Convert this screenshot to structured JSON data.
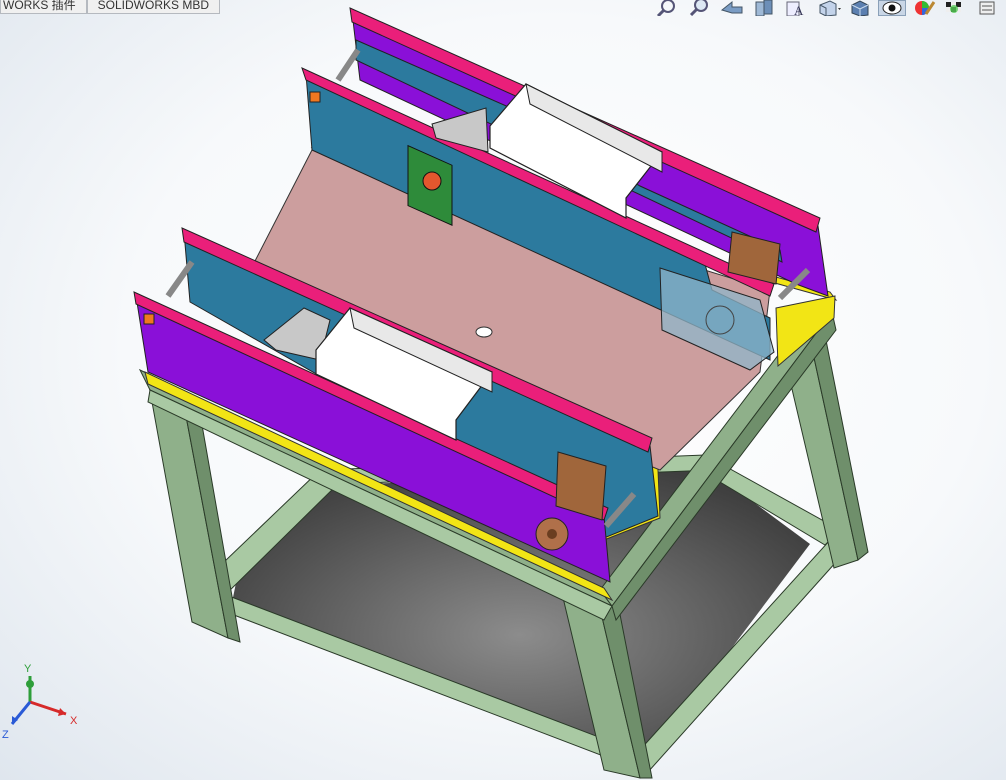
{
  "app": {
    "name": "SOLIDWORKS"
  },
  "command_manager": {
    "tabs": [
      {
        "label": "WORKS 插件"
      },
      {
        "label": "SOLIDWORKS MBD"
      }
    ]
  },
  "heads_up_toolbar": {
    "buttons": [
      {
        "icon": "zoom-to-fit-icon"
      },
      {
        "icon": "zoom-to-area-icon"
      },
      {
        "icon": "previous-view-icon"
      },
      {
        "icon": "section-view-icon"
      },
      {
        "icon": "dynamic-annotation-views-icon"
      },
      {
        "icon": "view-orientation-icon"
      },
      {
        "icon": "display-style-icon"
      },
      {
        "icon": "hide-show-items-icon"
      },
      {
        "icon": "edit-appearance-icon"
      },
      {
        "icon": "apply-scene-icon"
      },
      {
        "icon": "view-settings-icon"
      }
    ]
  },
  "triad": {
    "x_label": "X",
    "y_label": "Y",
    "z_label": "Z"
  },
  "colors": {
    "frame": "#8fb08a",
    "frame_light": "#a9c9a3",
    "frame_dark": "#6f8f6b",
    "top_plate": "#cc9e9e",
    "purple_panel": "#8a10d8",
    "blue_panel": "#2c7a9e",
    "pink_rail": "#ea1f7a",
    "yellow_base": "#f2e515",
    "shelf": "#4a4a4a",
    "bin": "#ffffff",
    "motor": "#a0663b"
  }
}
